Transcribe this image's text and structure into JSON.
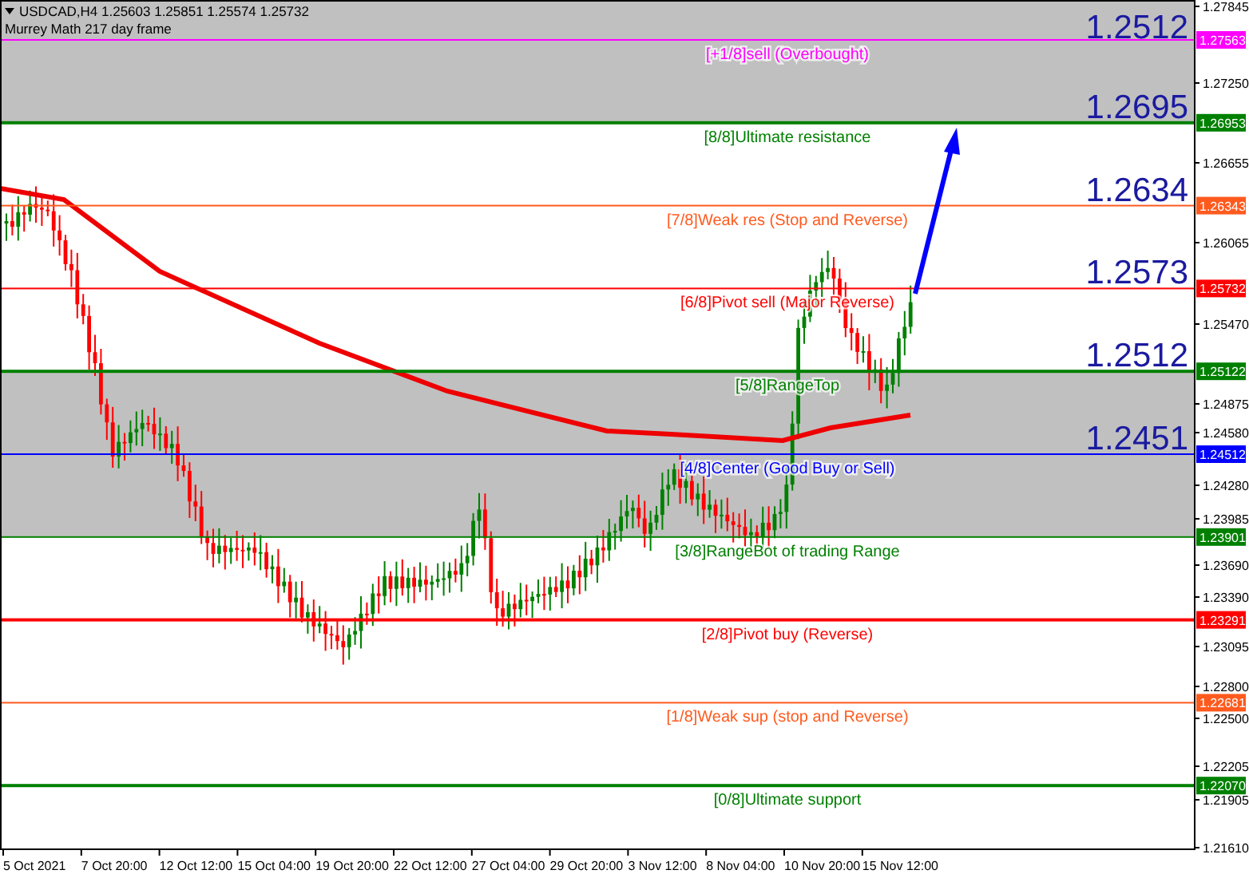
{
  "header": {
    "symbol": "USDCAD,H4",
    "ohlc": "1.25603 1.25851 1.25574 1.25732",
    "indicator": "Murrey Math 217 day frame"
  },
  "levels": [
    {
      "label": "[+1/8]sell (Overbought)",
      "price_tag": "1.27563",
      "color": "#ff00ff",
      "shaded": true
    },
    {
      "label": "[8/8]Ultimate resistance",
      "price_tag": "1.26953",
      "color": "#008000",
      "shaded": false
    },
    {
      "label": "[7/8]Weak res (Stop and Reverse)",
      "price_tag": "1.26343",
      "color": "#ff5a1e",
      "shaded": false
    },
    {
      "label": "[6/8]Pivot sell (Major Reverse)",
      "price_tag": "1.25732",
      "color": "#ff0000",
      "shaded": false
    },
    {
      "label": "[5/8]RangeTop",
      "price_tag": "1.25122",
      "color": "#008000",
      "shaded": true
    },
    {
      "label": "[4/8]Center (Good Buy or Sell)",
      "price_tag": "1.24512",
      "color": "#0000ff",
      "shaded": true
    },
    {
      "label": "[3/8]RangeBot of trading Range",
      "price_tag": "1.23901",
      "color": "#008000",
      "shaded": false
    },
    {
      "label": "[2/8]Pivot buy (Reverse)",
      "price_tag": "1.23291",
      "color": "#ff0000",
      "shaded": false
    },
    {
      "label": "[1/8]Weak sup (stop and Reverse)",
      "price_tag": "1.22681",
      "color": "#ff5a1e",
      "shaded": false
    },
    {
      "label": "[0/8]Ultimate support",
      "price_tag": "1.22070",
      "color": "#008000",
      "shaded": false
    }
  ],
  "targets": [
    "1.2512",
    "1.2695",
    "1.2634",
    "1.2573",
    "1.2512",
    "1.2451"
  ],
  "price_axis": [
    "1.27845",
    "1.27250",
    "1.26655",
    "1.26065",
    "1.25470",
    "1.24875",
    "1.24580",
    "1.24280",
    "1.23985",
    "1.23690",
    "1.23390",
    "1.23095",
    "1.22800",
    "1.22500",
    "1.22205",
    "1.21905",
    "1.21610"
  ],
  "time_axis": [
    "5 Oct 2021",
    "7 Oct 20:00",
    "12 Oct 12:00",
    "15 Oct 04:00",
    "19 Oct 20:00",
    "22 Oct 12:00",
    "27 Oct 04:00",
    "29 Oct 20:00",
    "3 Nov 12:00",
    "8 Nov 04:00",
    "10 Nov 20:00",
    "15 Nov 12:00"
  ]
}
